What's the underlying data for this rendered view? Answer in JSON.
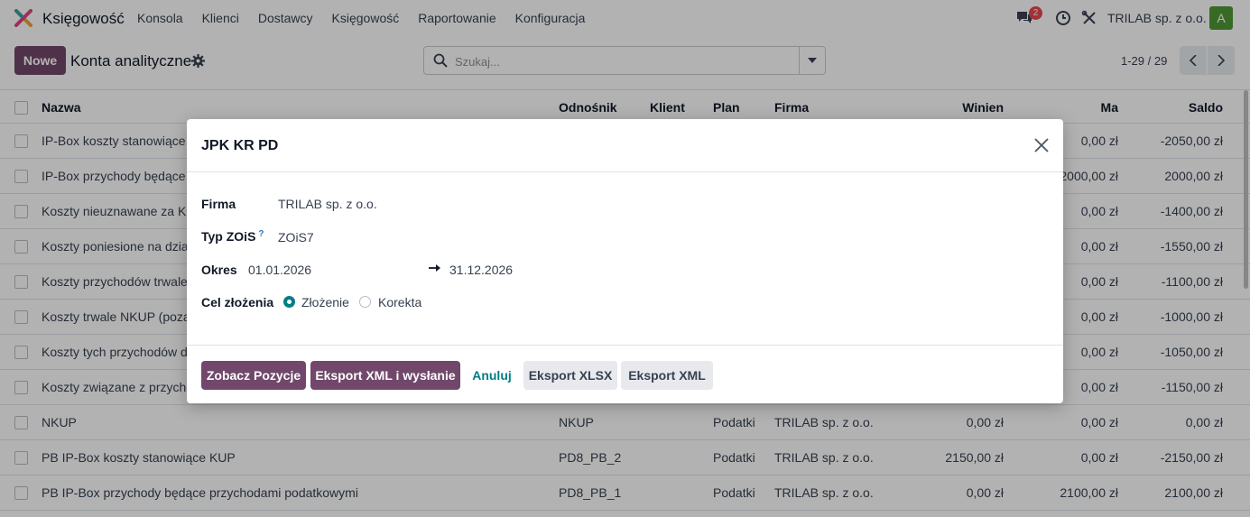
{
  "navbar": {
    "app_name": "Księgowość",
    "menu": [
      "Konsola",
      "Klienci",
      "Dostawcy",
      "Księgowość",
      "Raportowanie",
      "Konfiguracja"
    ],
    "message_badge": "2",
    "company": "TRILAB sp. z o.o.",
    "avatar_letter": "A",
    "avatar_color": "#4f9a36"
  },
  "control": {
    "new_label": "Nowe",
    "title": "Konta analityczne",
    "search_placeholder": "Szukaj...",
    "pager": "1-29 / 29"
  },
  "list": {
    "headers": {
      "name": "Nazwa",
      "ref": "Odnośnik",
      "client": "Klient",
      "plan": "Plan",
      "firm": "Firma",
      "winien": "Winien",
      "ma": "Ma",
      "saldo": "Saldo"
    },
    "rows": [
      {
        "name": "IP-Box koszty stanowiące K",
        "ref": "",
        "plan": "",
        "firm": "",
        "winien": "",
        "ma": "0,00 zł",
        "saldo": "-2050,00 zł"
      },
      {
        "name": "IP-Box przychody będące p",
        "ref": "",
        "plan": "",
        "firm": "",
        "winien": "",
        "ma": "2000,00 zł",
        "saldo": "2000,00 zł"
      },
      {
        "name": "Koszty nieuznawane za KU",
        "ref": "",
        "plan": "",
        "firm": "",
        "winien": "",
        "ma": "0,00 zł",
        "saldo": "-1400,00 zł"
      },
      {
        "name": "Koszty poniesione na dzia",
        "ref": "",
        "plan": "",
        "firm": "",
        "winien": "",
        "ma": "0,00 zł",
        "saldo": "-1550,00 zł"
      },
      {
        "name": "Koszty przychodów trwale",
        "ref": "",
        "plan": "",
        "firm": "",
        "winien": "",
        "ma": "0,00 zł",
        "saldo": "-1100,00 zł"
      },
      {
        "name": "Koszty trwale NKUP (poza",
        "ref": "",
        "plan": "",
        "firm": "",
        "winien": "",
        "ma": "0,00 zł",
        "saldo": "-1000,00 zł"
      },
      {
        "name": "Koszty tych przychodów d",
        "ref": "",
        "plan": "",
        "firm": "",
        "winien": "",
        "ma": "0,00 zł",
        "saldo": "-1050,00 zł"
      },
      {
        "name": "Koszty związane z przycho",
        "ref": "",
        "plan": "",
        "firm": "",
        "winien": "",
        "ma": "0,00 zł",
        "saldo": "-1150,00 zł"
      },
      {
        "name": "NKUP",
        "ref": "NKUP",
        "plan": "Podatki",
        "firm": "TRILAB sp. z o.o.",
        "winien": "0,00 zł",
        "ma": "0,00 zł",
        "saldo": "0,00 zł"
      },
      {
        "name": "PB IP-Box koszty stanowiące KUP",
        "ref": "PD8_PB_2",
        "plan": "Podatki",
        "firm": "TRILAB sp. z o.o.",
        "winien": "2150,00 zł",
        "ma": "0,00 zł",
        "saldo": "-2150,00 zł"
      },
      {
        "name": "PB IP-Box przychody będące przychodami podatkowymi",
        "ref": "PD8_PB_1",
        "plan": "Podatki",
        "firm": "TRILAB sp. z o.o.",
        "winien": "0,00 zł",
        "ma": "2100,00 zł",
        "saldo": "2100,00 zł"
      }
    ]
  },
  "dialog": {
    "title": "JPK KR PD",
    "firma_label": "Firma",
    "firma_value": "TRILAB sp. z o.o.",
    "typ_label": "Typ ZOiS",
    "typ_help": "?",
    "typ_value": "ZOiS7",
    "okres_label": "Okres",
    "okres_from": "01.01.2026",
    "okres_to": "31.12.2026",
    "cel_label": "Cel złożenia",
    "cel_option1": "Złożenie",
    "cel_option2": "Korekta",
    "cel_selected": "Złożenie",
    "btn_zobacz": "Zobacz Pozycje",
    "btn_eksport_xml_send": "Eksport XML i wysłanie",
    "btn_anuluj": "Anuluj",
    "btn_xlsx": "Eksport XLSX",
    "btn_xml": "Eksport XML"
  },
  "colors": {
    "primary": "#71486b",
    "accent": "#017e84",
    "badge": "#e5484d"
  }
}
